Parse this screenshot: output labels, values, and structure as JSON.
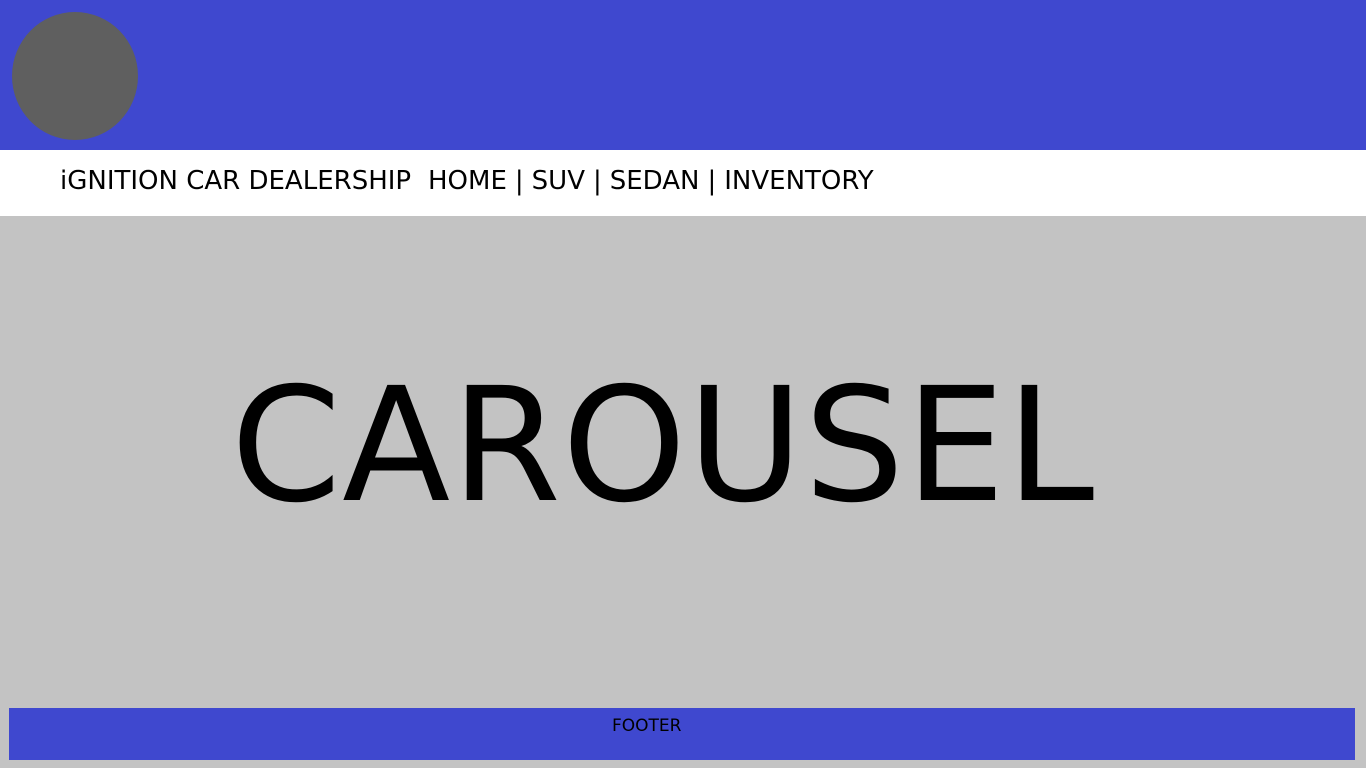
{
  "header": {
    "logo_label": "",
    "colors": {
      "header": "#3f48cf",
      "logo": "#5f5f5f",
      "nav": "#ffffff",
      "content": "#c3c3c3"
    }
  },
  "nav": {
    "brand": "iGNITION CAR DEALERSHIP",
    "links": [
      {
        "label": "HOME"
      },
      {
        "label": "SUV"
      },
      {
        "label": "SEDAN"
      },
      {
        "label": "INVENTORY"
      }
    ],
    "separator": "|"
  },
  "carousel": {
    "title": "CAROUSEL"
  },
  "footer": {
    "text": "FOOTER"
  }
}
